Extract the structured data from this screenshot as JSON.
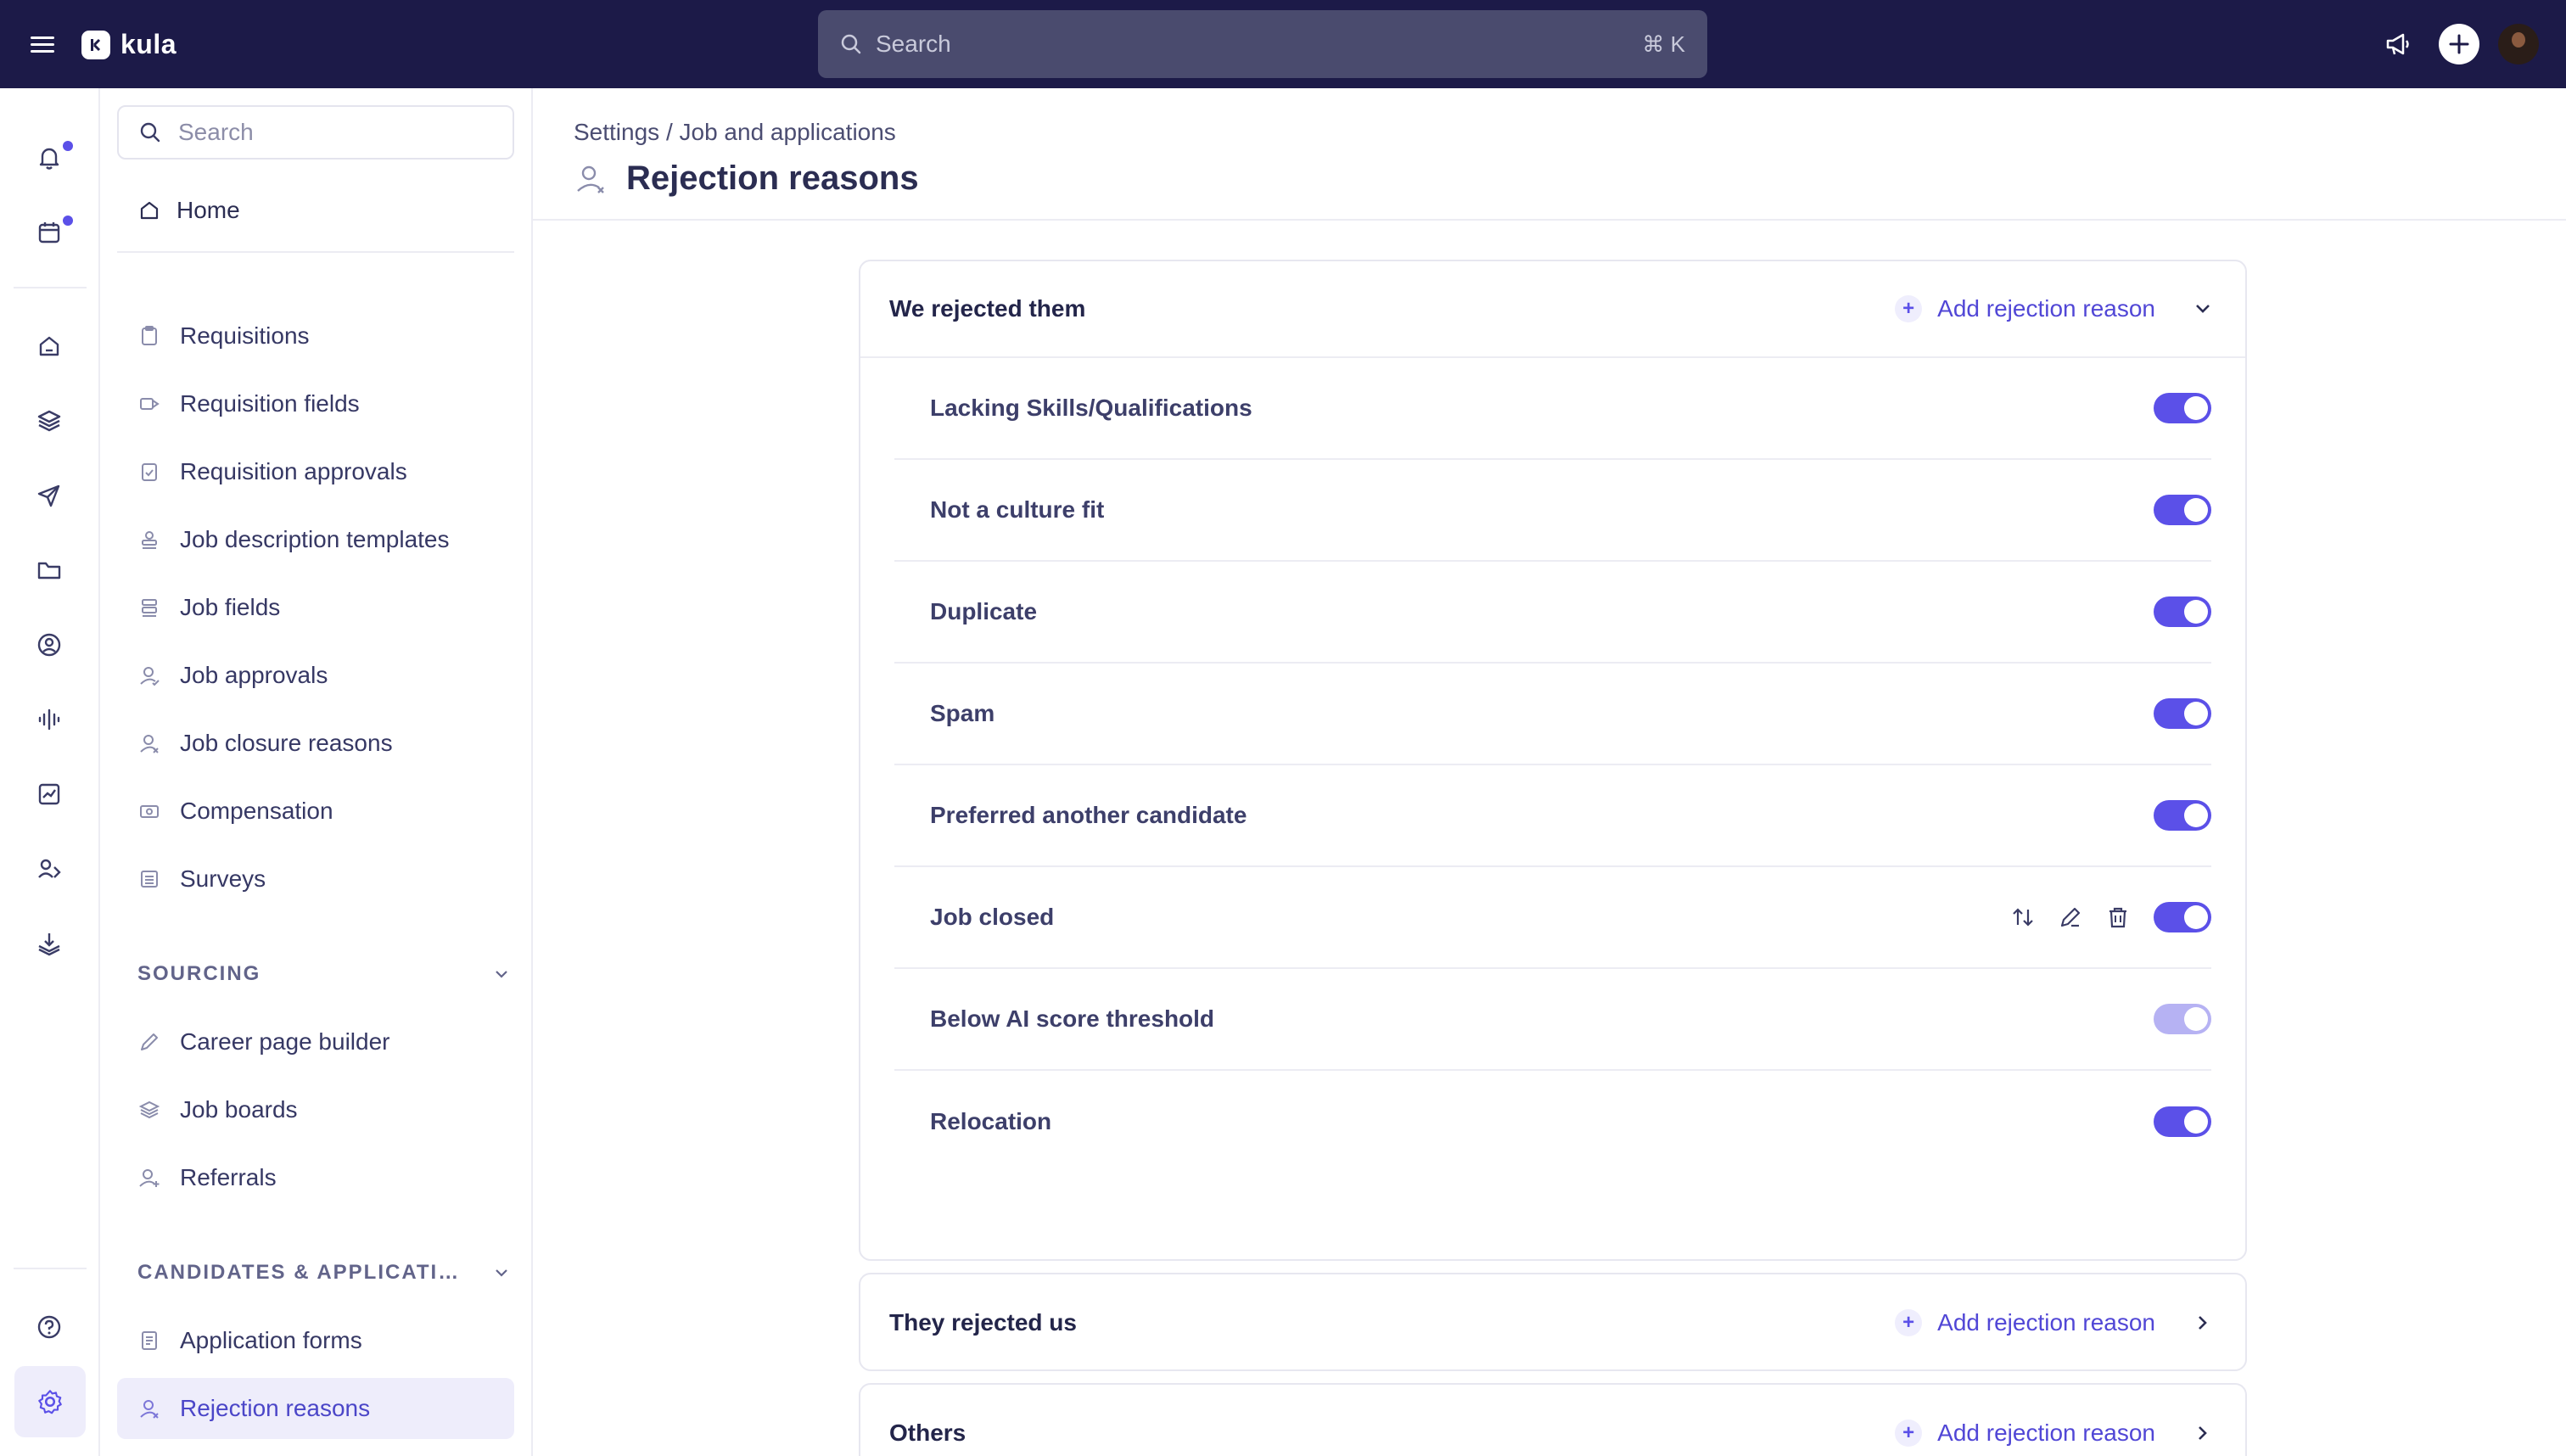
{
  "app": {
    "name": "kula",
    "search_placeholder": "Search",
    "search_shortcut": "⌘ K"
  },
  "sidebar": {
    "search_placeholder": "Search",
    "home_label": "Home",
    "items": [
      {
        "label": "Requisitions",
        "icon": "clipboard-icon"
      },
      {
        "label": "Requisition fields",
        "icon": "tag-icon"
      },
      {
        "label": "Requisition approvals",
        "icon": "clipboard-check-icon"
      },
      {
        "label": "Job description templates",
        "icon": "stamp-icon"
      },
      {
        "label": "Job fields",
        "icon": "stamp-icon"
      },
      {
        "label": "Job approvals",
        "icon": "user-check-icon"
      },
      {
        "label": "Job closure reasons",
        "icon": "user-x-icon"
      },
      {
        "label": "Compensation",
        "icon": "banknote-icon"
      },
      {
        "label": "Surveys",
        "icon": "list-icon"
      }
    ],
    "sourcing": {
      "title": "SOURCING",
      "items": [
        {
          "label": "Career page builder",
          "icon": "pen-icon"
        },
        {
          "label": "Job boards",
          "icon": "layers-icon"
        },
        {
          "label": "Referrals",
          "icon": "user-plus-icon"
        }
      ]
    },
    "candidates": {
      "title": "CANDIDATES & APPLICATIONS",
      "items": [
        {
          "label": "Application forms",
          "icon": "form-icon"
        },
        {
          "label": "Rejection reasons",
          "icon": "user-x-icon",
          "active": true
        }
      ]
    }
  },
  "page": {
    "breadcrumb": "Settings / Job and applications",
    "title": "Rejection reasons"
  },
  "groups": [
    {
      "title": "We rejected them",
      "add_label": "Add rejection reason",
      "expanded": true,
      "reasons": [
        {
          "label": "Lacking Skills/Qualifications",
          "enabled": true
        },
        {
          "label": "Not a culture fit",
          "enabled": true
        },
        {
          "label": "Duplicate",
          "enabled": true
        },
        {
          "label": "Spam",
          "enabled": true
        },
        {
          "label": "Preferred another candidate",
          "enabled": true
        },
        {
          "label": "Job closed",
          "enabled": true,
          "hovered": true
        },
        {
          "label": "Below AI score threshold",
          "enabled": true,
          "disabled_control": true
        },
        {
          "label": "Relocation",
          "enabled": true
        }
      ]
    },
    {
      "title": "They rejected us",
      "add_label": "Add rejection reason",
      "expanded": false
    },
    {
      "title": "Others",
      "add_label": "Add rejection reason",
      "expanded": false
    }
  ],
  "colors": {
    "topbar": "#1c1a48",
    "accent": "#5b50e8",
    "active_bg": "#eeedfb"
  }
}
